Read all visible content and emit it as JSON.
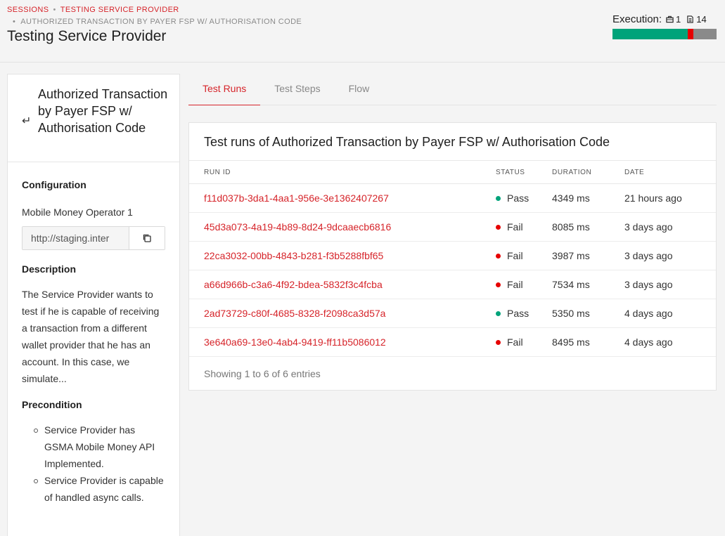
{
  "breadcrumb": {
    "items": [
      "SESSIONS",
      "TESTING SERVICE PROVIDER"
    ],
    "current": "AUTHORIZED TRANSACTION BY PAYER FSP W/ AUTHORISATION CODE"
  },
  "page_title": "Testing Service Provider",
  "execution": {
    "label": "Execution:",
    "case_count": "1",
    "step_count": "14",
    "progress": {
      "pass_fraction": 0.72,
      "fail_fraction": 0.06,
      "remaining_fraction": 0.22
    },
    "colors": {
      "pass": "#00a37a",
      "fail": "#e60000",
      "remaining": "#8a8a8a"
    }
  },
  "left_panel": {
    "back_icon": "return-arrow-icon",
    "title": "Authorized Transaction by Payer FSP w/ Authorisation Code",
    "configuration_heading": "Configuration",
    "operator": "Mobile Money Operator 1",
    "url": "http://staging.inter",
    "copy_icon": "copy-icon",
    "description_heading": "Description",
    "description": "The Service Provider wants to test if he is capable of receiving a transaction from a different wallet provider that he has an account. In this case, we simulate...",
    "precondition_heading": "Precondition",
    "preconditions": [
      "Service Provider has GSMA Mobile Money API Implemented.",
      "Service Provider is capable of handled async calls."
    ]
  },
  "tabs": [
    {
      "label": "Test Runs",
      "active": true
    },
    {
      "label": "Test Steps",
      "active": false
    },
    {
      "label": "Flow",
      "active": false
    }
  ],
  "runs": {
    "title": "Test runs of Authorized Transaction by Payer FSP w/ Authorisation Code",
    "columns": [
      "RUN ID",
      "STATUS",
      "DURATION",
      "DATE"
    ],
    "rows": [
      {
        "id": "f11d037b-3da1-4aa1-956e-3e1362407267",
        "status": "Pass",
        "duration": "4349 ms",
        "date": "21 hours ago"
      },
      {
        "id": "45d3a073-4a19-4b89-8d24-9dcaaecb6816",
        "status": "Fail",
        "duration": "8085 ms",
        "date": "3 days ago"
      },
      {
        "id": "22ca3032-00bb-4843-b281-f3b5288fbf65",
        "status": "Fail",
        "duration": "3987 ms",
        "date": "3 days ago"
      },
      {
        "id": "a66d966b-c3a6-4f92-bdea-5832f3c4fcba",
        "status": "Fail",
        "duration": "7534 ms",
        "date": "3 days ago"
      },
      {
        "id": "2ad73729-c80f-4685-8328-f2098ca3d57a",
        "status": "Pass",
        "duration": "5350 ms",
        "date": "4 days ago"
      },
      {
        "id": "3e640a69-13e0-4ab4-9419-ff11b5086012",
        "status": "Fail",
        "duration": "8495 ms",
        "date": "4 days ago"
      }
    ],
    "footer": "Showing 1 to 6 of 6 entries",
    "status_colors": {
      "Pass": "#00a37a",
      "Fail": "#e60000"
    }
  }
}
